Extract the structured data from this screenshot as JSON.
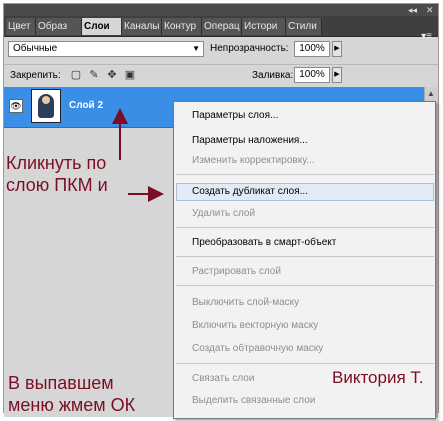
{
  "tabs": [
    "Цвет",
    "Образ",
    "Слои",
    "Каналы",
    "Контур",
    "Операц",
    "Истори",
    "Стили"
  ],
  "active_tab_index": 2,
  "blend_mode": "Обычные",
  "opacity_label": "Непрозрачность:",
  "opacity_value": "100%",
  "lock_label": "Закрепить:",
  "fill_label": "Заливка:",
  "fill_value": "100%",
  "layer_name": "Слой 2",
  "menu_items": [
    {
      "label": "Параметры слоя...",
      "enabled": true
    },
    {
      "label": "Параметры наложения...",
      "enabled": true
    },
    {
      "label": "Изменить корректировку...",
      "enabled": false
    },
    {
      "label": "Создать дубликат слоя...",
      "enabled": true
    },
    {
      "label": "Удалить слой",
      "enabled": false
    },
    {
      "label": "Преобразовать в смарт-объект",
      "enabled": true
    },
    {
      "label": "Растрировать слой",
      "enabled": false
    },
    {
      "label": "Выключить слой-маску",
      "enabled": false
    },
    {
      "label": "Включить векторную маску",
      "enabled": false
    },
    {
      "label": "Создать обтравочную маску",
      "enabled": false
    },
    {
      "label": "Связать слои",
      "enabled": false
    },
    {
      "label": "Выделить связанные слои",
      "enabled": false
    }
  ],
  "annotation_1_line1": "Кликнуть по",
  "annotation_1_line2": "слою ПКМ и",
  "annotation_2_line1": "В выпавшем",
  "annotation_2_line2": "меню жмем ОК",
  "signature": "Виктория Т.",
  "colors": {
    "accent": "#3a8ee6",
    "annotation": "#7a0f23",
    "panel": "#d6d6d6"
  },
  "icons": [
    "eye-icon",
    "lock-transparency-icon",
    "brush-icon",
    "move-icon",
    "lock-icon",
    "scroll-up-icon",
    "dropdown-arrow-icon",
    "panel-menu-icon"
  ]
}
